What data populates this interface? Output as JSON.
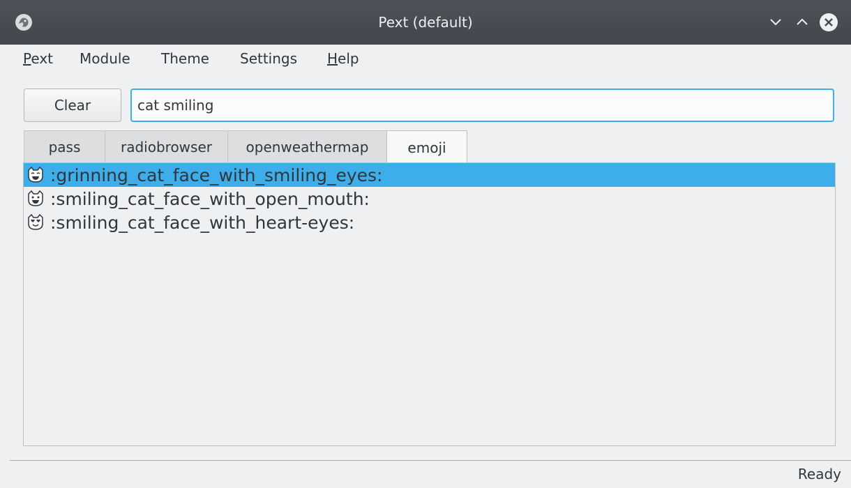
{
  "window": {
    "title": "Pext (default)",
    "icons": {
      "app": "pext-logo-icon",
      "minimize": "chevron-down-icon",
      "maximize": "chevron-up-icon",
      "close": "close-icon"
    }
  },
  "menu": {
    "items": [
      {
        "label": "Pext",
        "mnemonic": "P"
      },
      {
        "label": "Module"
      },
      {
        "label": "Theme"
      },
      {
        "label": "Settings"
      },
      {
        "label": "Help",
        "mnemonic": "H"
      }
    ]
  },
  "toolbar": {
    "clear_label": "Clear",
    "search_value": "cat smiling"
  },
  "tabs": [
    {
      "label": "pass",
      "active": false
    },
    {
      "label": "radiobrowser",
      "active": false
    },
    {
      "label": "openweathermap",
      "active": false
    },
    {
      "label": "emoji",
      "active": true
    }
  ],
  "results": [
    {
      "label": ":grinning_cat_face_with_smiling_eyes:",
      "icon": "grinning-cat-icon",
      "selected": true
    },
    {
      "label": ":smiling_cat_face_with_open_mouth:",
      "icon": "smiling-cat-icon",
      "selected": false
    },
    {
      "label": ":smiling_cat_face_with_heart-eyes:",
      "icon": "heart-eyes-cat-icon",
      "selected": false
    }
  ],
  "status": {
    "text": "Ready"
  },
  "colors": {
    "accent": "#3daee9",
    "titlebar": "#474b50",
    "background": "#eff0f1",
    "text": "#31363b"
  }
}
